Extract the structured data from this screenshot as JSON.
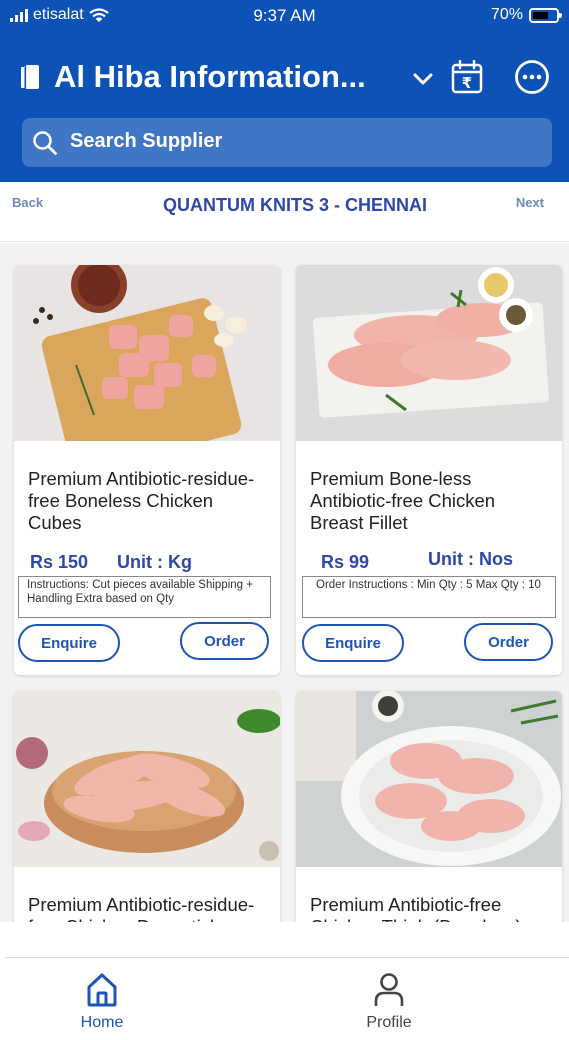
{
  "status_bar": {
    "carrier": "etisalat",
    "time": "9:37 AM",
    "battery": "70%",
    "battery_level": 0.7
  },
  "header": {
    "title": "Al Hiba Information...",
    "icons": [
      "book-icon",
      "chevron-down-icon",
      "calendar-rupee-icon",
      "more-icon"
    ]
  },
  "search": {
    "placeholder": "Search Supplier"
  },
  "nav": {
    "back": "Back",
    "title": "QUANTUM KNITS 3 - CHENNAI",
    "next": "Next"
  },
  "products": [
    {
      "name": "Premium Antibiotic-residue-free Boneless Chicken Cubes",
      "price": "Rs 150",
      "unit": "Unit : Kg",
      "instructions": "Instructions:  Cut pieces available Shipping + Handling Extra based on Qty",
      "enquire": "Enquire",
      "order": "Order"
    },
    {
      "name": "Premium Bone-less Antibiotic-free Chicken Breast Fillet",
      "price": "Rs 99",
      "unit": "Unit : Nos",
      "instructions": "Order Instructions : Min Qty : 5 Max Qty : 10",
      "enquire": "Enquire",
      "order": "Order"
    },
    {
      "name": "Premium Antibiotic-residue-free Chicken Drumsticks"
    },
    {
      "name": "Premium Antibiotic-free Chicken Thigh (Boneless)"
    }
  ],
  "tabs": [
    {
      "label": "Home",
      "icon": "home-icon",
      "active": true
    },
    {
      "label": "Profile",
      "icon": "profile-icon",
      "active": false
    }
  ],
  "colors": {
    "primary": "#0d52b6",
    "accent": "#2f47a6",
    "button": "#1e55b3",
    "background": "#f2f2f2"
  }
}
